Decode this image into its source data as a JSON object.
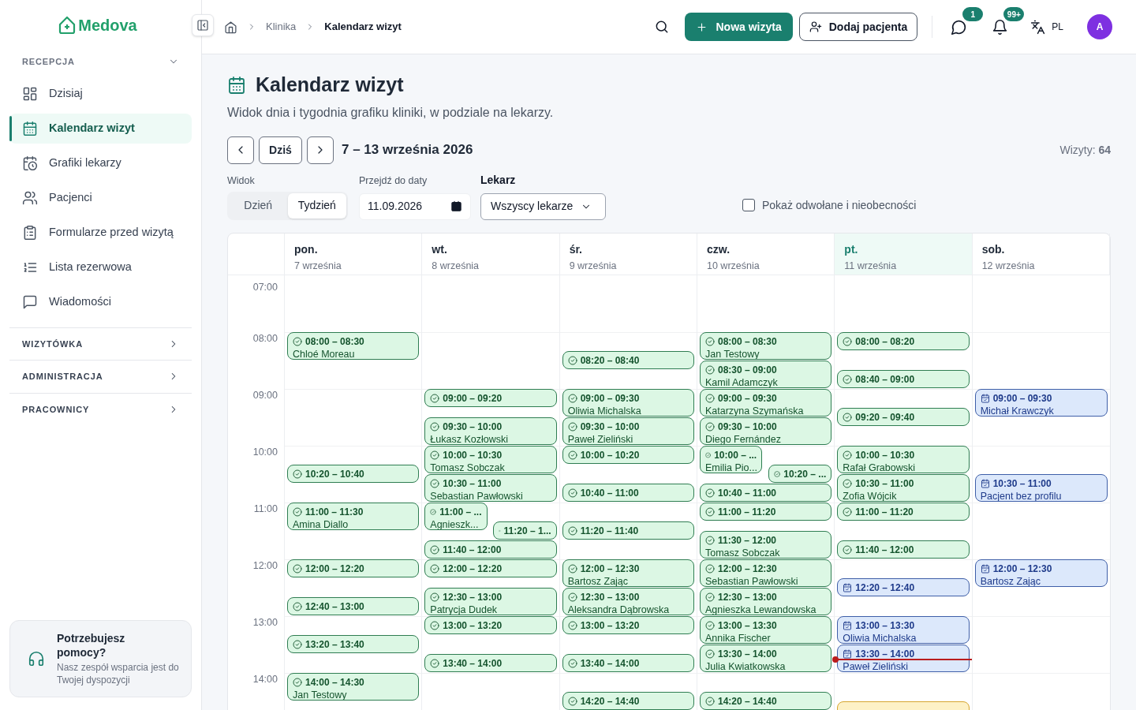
{
  "sidebar": {
    "logo": "Medova",
    "sections": [
      {
        "title": "RECEPCJA",
        "expanded": true,
        "items": [
          {
            "label": "Dzisiaj",
            "selected": false
          },
          {
            "label": "Kalendarz wizyt",
            "selected": true
          },
          {
            "label": "Grafiki lekarzy",
            "selected": false
          },
          {
            "label": "Pacjenci",
            "selected": false
          },
          {
            "label": "Formularze przed wizytą",
            "selected": false
          },
          {
            "label": "Lista rezerwowa",
            "selected": false
          },
          {
            "label": "Wiadomości",
            "selected": false
          }
        ]
      },
      {
        "title": "WIZYTÓWKA",
        "expanded": false
      },
      {
        "title": "ADMINISTRACJA",
        "expanded": false
      },
      {
        "title": "PRACOWNICY",
        "expanded": false
      }
    ],
    "help": {
      "title": "Potrzebujesz pomocy?",
      "text": "Nasz zespół wsparcia jest do Twojej dyspozycji"
    }
  },
  "breadcrumb": [
    {
      "label": "Klinika",
      "current": false
    },
    {
      "label": "Kalendarz wizyt",
      "current": true
    }
  ],
  "header": {
    "primary_button": "Nowa wizyta",
    "secondary_button": "Dodaj pacjenta",
    "notifications": [
      {
        "kind": "chat",
        "badge": "1"
      },
      {
        "kind": "bell",
        "badge": "99+"
      }
    ],
    "language": "PL",
    "avatar": "A"
  },
  "page": {
    "title": "Kalendarz wizyt",
    "subtitle": "Widok dnia i tygodnia grafiku kliniki, w podziale na lekarzy.",
    "today_button": "Dziś",
    "range": "7 – 13 września 2026",
    "count": "Wizyty: **64**",
    "view_label": "Widok",
    "views": [
      {
        "label": "Dzień",
        "selected": false
      },
      {
        "label": "Tydzień",
        "selected": true
      }
    ],
    "date_label": "Przejdź do daty",
    "date_value": "11.09.2026",
    "doctor_label": "Lekarz",
    "doctor_value": "Wszyscy lekarze",
    "show_cancelled": {
      "label": "Pokaż odwołane i nieobecności",
      "checked": false
    }
  },
  "calendar": {
    "hours": [
      "07:00",
      "08:00",
      "09:00",
      "10:00",
      "11:00",
      "12:00",
      "13:00",
      "14:00"
    ],
    "days": [
      {
        "day": "pon.",
        "date": "7 września",
        "today": false,
        "events": [
          {
            "kind": "confirmed",
            "time": "08:00 – 08:30",
            "name": "Chloé Moreau"
          },
          {
            "kind": "confirmed",
            "time": "10:20 – 10:40"
          },
          {
            "kind": "confirmed",
            "time": "11:00 – 11:30",
            "name": "Amina Diallo"
          },
          {
            "kind": "confirmed",
            "time": "12:00 – 12:20"
          },
          {
            "kind": "confirmed",
            "time": "12:40 – 13:00"
          },
          {
            "kind": "confirmed",
            "time": "13:20 – 13:40"
          },
          {
            "kind": "confirmed",
            "time": "14:00 – 14:30",
            "name": "Jan Testowy"
          }
        ]
      },
      {
        "day": "wt.",
        "date": "8 września",
        "today": false,
        "events": [
          {
            "kind": "confirmed",
            "time": "09:00 – 09:20"
          },
          {
            "kind": "confirmed",
            "time": "09:30 – 10:00",
            "name": "Łukasz Kozłowski"
          },
          {
            "kind": "confirmed",
            "time": "10:00 – 10:30",
            "name": "Tomasz Sobczak"
          },
          {
            "kind": "confirmed",
            "time": "10:30 – 11:00",
            "name": "Sebastian Pawłowski"
          },
          {
            "kind": "confirmed",
            "time": "11:00 – ...",
            "name": "Agnieszk..."
          },
          {
            "kind": "confirmed",
            "time": "11:20 – 1..."
          },
          {
            "kind": "confirmed",
            "time": "11:40 – 12:00"
          },
          {
            "kind": "confirmed",
            "time": "12:00 – 12:20"
          },
          {
            "kind": "confirmed",
            "time": "12:30 – 13:00",
            "name": "Patrycja Dudek"
          },
          {
            "kind": "confirmed",
            "time": "13:00 – 13:20"
          },
          {
            "kind": "confirmed",
            "time": "13:40 – 14:00"
          }
        ]
      },
      {
        "day": "śr.",
        "date": "9 września",
        "today": false,
        "events": [
          {
            "kind": "confirmed",
            "time": "08:20 – 08:40"
          },
          {
            "kind": "confirmed",
            "time": "09:00 – 09:30",
            "name": "Oliwia Michalska"
          },
          {
            "kind": "confirmed",
            "time": "09:30 – 10:00",
            "name": "Paweł Zieliński"
          },
          {
            "kind": "confirmed",
            "time": "10:00 – 10:20"
          },
          {
            "kind": "confirmed",
            "time": "10:40 – 11:00"
          },
          {
            "kind": "confirmed",
            "time": "11:20 – 11:40"
          },
          {
            "kind": "confirmed",
            "time": "12:00 – 12:30",
            "name": "Bartosz Zając"
          },
          {
            "kind": "confirmed",
            "time": "12:30 – 13:00",
            "name": "Aleksandra Dąbrowska"
          },
          {
            "kind": "confirmed",
            "time": "13:00 – 13:20"
          },
          {
            "kind": "confirmed",
            "time": "13:40 – 14:00"
          },
          {
            "kind": "confirmed",
            "time": "14:20 – 14:40"
          }
        ]
      },
      {
        "day": "czw.",
        "date": "10 września",
        "today": false,
        "events": [
          {
            "kind": "confirmed",
            "time": "08:00 – 08:30",
            "name": "Jan Testowy"
          },
          {
            "kind": "confirmed",
            "time": "08:30 – 09:00",
            "name": "Kamil Adamczyk"
          },
          {
            "kind": "confirmed",
            "time": "09:00 – 09:30",
            "name": "Katarzyna Szymańska"
          },
          {
            "kind": "confirmed",
            "time": "09:30 – 10:00",
            "name": "Diego Fernández"
          },
          {
            "kind": "confirmed",
            "time": "10:00 – ...",
            "name": "Emilia Pio..."
          },
          {
            "kind": "confirmed",
            "time": "10:20 – ..."
          },
          {
            "kind": "confirmed",
            "time": "10:40 – 11:00"
          },
          {
            "kind": "confirmed",
            "time": "11:00 – 11:20"
          },
          {
            "kind": "confirmed",
            "time": "11:30 – 12:00",
            "name": "Tomasz Sobczak"
          },
          {
            "kind": "confirmed",
            "time": "12:00 – 12:30",
            "name": "Sebastian Pawłowski"
          },
          {
            "kind": "confirmed",
            "time": "12:30 – 13:00",
            "name": "Agnieszka Lewandowska"
          },
          {
            "kind": "confirmed",
            "time": "13:00 – 13:30",
            "name": "Annika Fischer"
          },
          {
            "kind": "confirmed",
            "time": "13:30 – 14:00",
            "name": "Julia Kwiatkowska"
          },
          {
            "kind": "confirmed",
            "time": "14:20 – 14:40"
          }
        ]
      },
      {
        "day": "pt.",
        "date": "11 września",
        "today": true,
        "events": [
          {
            "kind": "confirmed",
            "time": "08:00 – 08:20"
          },
          {
            "kind": "confirmed",
            "time": "08:40 – 09:00"
          },
          {
            "kind": "confirmed",
            "time": "09:20 – 09:40"
          },
          {
            "kind": "confirmed",
            "time": "10:00 – 10:30",
            "name": "Rafał Grabowski"
          },
          {
            "kind": "confirmed",
            "time": "10:30 – 11:00",
            "name": "Zofia Wójcik"
          },
          {
            "kind": "confirmed",
            "time": "11:00 – 11:20"
          },
          {
            "kind": "confirmed",
            "time": "11:40 – 12:00"
          },
          {
            "kind": "scheduled",
            "time": "12:20 – 12:40"
          },
          {
            "kind": "scheduled",
            "time": "13:00 – 13:30",
            "name": "Oliwia Michalska"
          },
          {
            "kind": "scheduled",
            "time": "13:30 – 14:00",
            "name": "Paweł Zieliński"
          },
          {
            "kind": "pending"
          }
        ]
      },
      {
        "day": "sob.",
        "date": "12 września",
        "today": false,
        "events": [
          {
            "kind": "scheduled",
            "time": "09:00 – 09:30",
            "name": "Michał Krawczyk"
          },
          {
            "kind": "scheduled",
            "time": "10:30 – 11:00",
            "name": "Pacjent bez profilu"
          },
          {
            "kind": "scheduled",
            "time": "12:00 – 12:30",
            "name": "Bartosz Zając"
          }
        ]
      }
    ]
  }
}
